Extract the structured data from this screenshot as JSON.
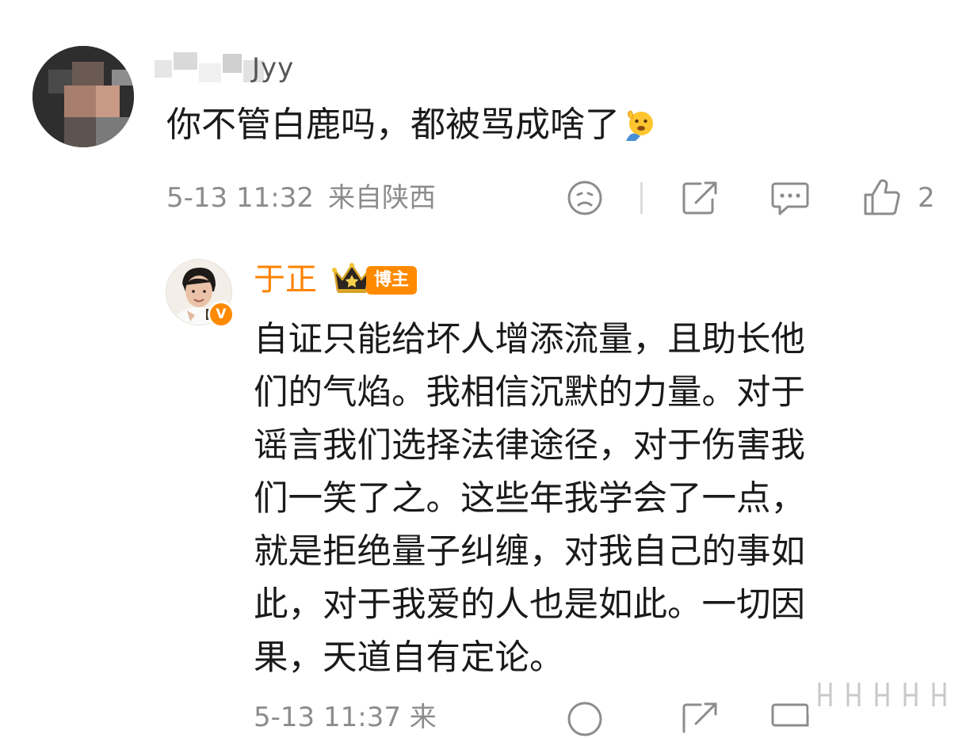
{
  "comment": {
    "author_visible_suffix": "Jyy",
    "text": "你不管白鹿吗，都被骂成啥了",
    "emoji": "salute-face-emoji",
    "timestamp": "5-13 11:32",
    "location": "来自陕西",
    "like_count": "2"
  },
  "reply": {
    "author": "于正",
    "badge": "博主",
    "verified_icon": "V",
    "lines": [
      "自证只能给坏人增添流量，且助长他",
      "们的气焰。我相信沉默的力量。对于",
      "谣言我们选择法律途径，对于伤害我",
      "们一笑了之。这些年我学会了一点，",
      "就是拒绝量子纠缠，对我自己的事如",
      "此，对于我爱的人也是如此。一切因",
      "果，天道自有定论。"
    ],
    "timestamp_partial": "5-13 11:37 来"
  },
  "icons": {
    "dislike": "sad-face-icon",
    "share": "share-icon",
    "comment": "comment-icon",
    "like": "thumbs-up-icon"
  },
  "colors": {
    "accent_orange": "#ff8200",
    "meta_gray": "#8c8c8c"
  }
}
